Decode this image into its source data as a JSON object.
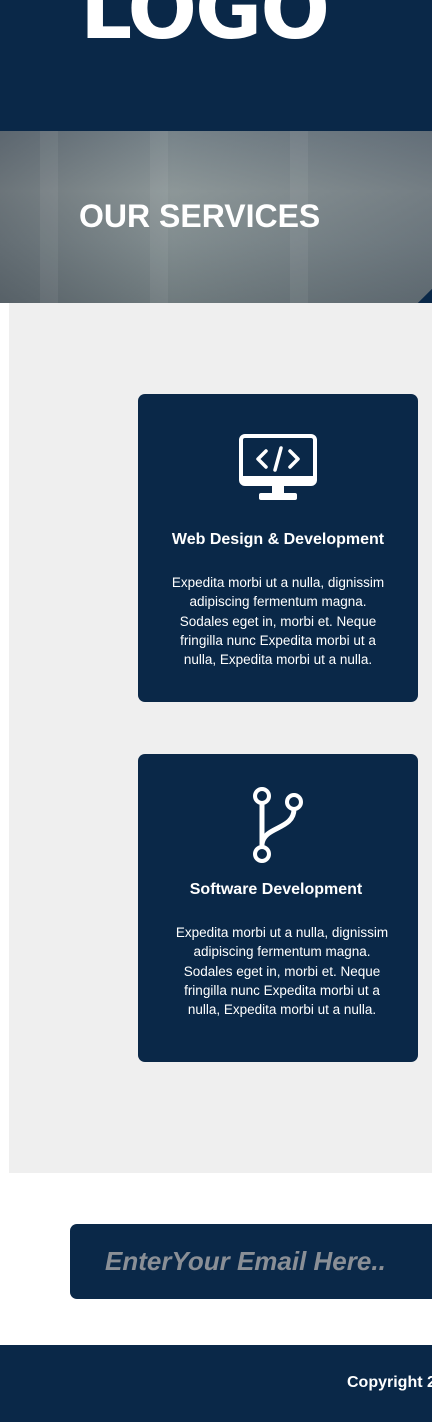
{
  "header": {
    "logo_text": "LOGO"
  },
  "hero": {
    "title": "OUR SERVICES"
  },
  "services": [
    {
      "icon": "monitor-code-icon",
      "title": "Web Design & Development",
      "text": "Expedita morbi ut a nulla, dignissim\nadipiscing fermentum magna.\nSodales eget in, morbi et. Neque\nfringilla nunc Expedita morbi ut a\nnulla, Expedita morbi ut a nulla."
    },
    {
      "icon": "code-branch-icon",
      "title": "Software Development",
      "text": "Expedita morbi ut a nulla, dignissim\nadipiscing fermentum magna.\nSodales eget in, morbi et. Neque\nfringilla nunc Expedita morbi ut a\nnulla, Expedita morbi ut a nulla."
    }
  ],
  "newsletter": {
    "email_placeholder": "EnterYour Email Here..",
    "email_value": ""
  },
  "footer": {
    "copyright": "Copyright 2"
  },
  "colors": {
    "primary": "#0a2848",
    "section_bg": "#efefef",
    "placeholder": "#8a8f96"
  }
}
